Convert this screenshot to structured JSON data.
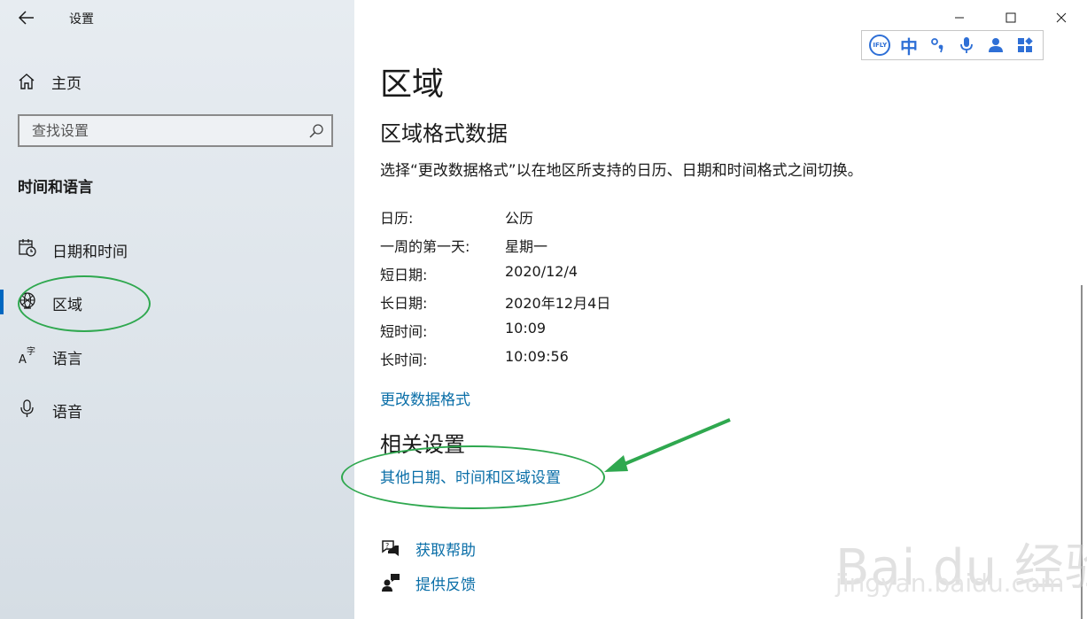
{
  "window": {
    "title": "设置",
    "controls": [
      "minimize",
      "maximize",
      "close"
    ]
  },
  "sidebar": {
    "home_label": "主页",
    "search_placeholder": "查找设置",
    "section_title": "时间和语言",
    "items": [
      {
        "label": "日期和时间",
        "icon": "calendar-clock-icon",
        "active": false
      },
      {
        "label": "区域",
        "icon": "globe-icon",
        "active": true
      },
      {
        "label": "语言",
        "icon": "language-icon",
        "active": false
      },
      {
        "label": "语音",
        "icon": "microphone-icon",
        "active": false
      }
    ]
  },
  "ime_toolbar": {
    "logo": "IFLY",
    "mode": "中",
    "buttons": [
      "punctuation-icon",
      "microphone-icon",
      "user-icon",
      "apps-icon"
    ]
  },
  "main": {
    "title": "区域",
    "subtitle": "区域格式数据",
    "description": "选择“更改数据格式”以在地区所支持的日历、日期和时间格式之间切换。",
    "formats": [
      {
        "key": "日历:",
        "value": "公历"
      },
      {
        "key": "一周的第一天:",
        "value": "星期一"
      },
      {
        "key": "短日期:",
        "value": "2020/12/4"
      },
      {
        "key": "长日期:",
        "value": "2020年12月4日"
      },
      {
        "key": "短时间:",
        "value": "10:09"
      },
      {
        "key": "长时间:",
        "value": "10:09:56"
      }
    ],
    "change_format_link": "更改数据格式",
    "related_title": "相关设置",
    "related_link": "其他日期、时间和区域设置",
    "help_link": "获取帮助",
    "feedback_link": "提供反馈"
  },
  "watermark": {
    "text": "Bai du 经验",
    "sub": "jingyan.baidu.com"
  },
  "colors": {
    "accent": "#0067c0",
    "link": "#0b6fa8",
    "annotation": "#2fa84f",
    "ime": "#2e6fd6"
  }
}
